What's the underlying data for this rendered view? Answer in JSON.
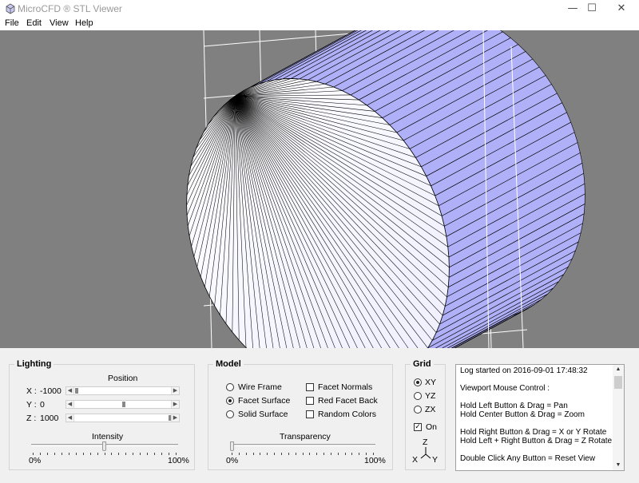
{
  "window": {
    "title": "MicroCFD ® STL Viewer",
    "minimize": "—",
    "maximize": "☐",
    "close": "✕"
  },
  "menu": [
    "File",
    "Edit",
    "View",
    "Help"
  ],
  "colors": {
    "viewport_bg": "#808080",
    "model_fill": "#b0b0f8",
    "model_lit": "#eeeeff",
    "grid": "#ffffff"
  },
  "lighting": {
    "title": "Lighting",
    "position_label": "Position",
    "x": {
      "label": "X :",
      "value": "-1000",
      "fraction": 0.0
    },
    "y": {
      "label": "Y :",
      "value": "0",
      "fraction": 0.5
    },
    "z": {
      "label": "Z :",
      "value": "1000",
      "fraction": 1.0
    },
    "intensity_label": "Intensity",
    "intensity_fraction": 0.5,
    "min_label": "0%",
    "max_label": "100%"
  },
  "model": {
    "title": "Model",
    "options": [
      {
        "label": "Wire Frame",
        "selected": false
      },
      {
        "label": "Facet Surface",
        "selected": true
      },
      {
        "label": "Solid Surface",
        "selected": false
      }
    ],
    "checks": [
      {
        "label": "Facet Normals",
        "checked": false
      },
      {
        "label": "Red Facet Back",
        "checked": false
      },
      {
        "label": "Random Colors",
        "checked": false
      }
    ],
    "transparency_label": "Transparency",
    "transparency_fraction": 0.0,
    "min_label": "0%",
    "max_label": "100%"
  },
  "grid": {
    "title": "Grid",
    "planes": [
      {
        "label": "XY",
        "selected": true
      },
      {
        "label": "YZ",
        "selected": false
      },
      {
        "label": "ZX",
        "selected": false
      }
    ],
    "on_label": "On",
    "on_checked": true,
    "axis_z": "Z",
    "axis_x": "X",
    "axis_y": "Y"
  },
  "log": {
    "lines": [
      "Log started on 2016-09-01 17:48:32",
      "Viewport Mouse Control :",
      "Hold Left Button & Drag  =  Pan",
      "Hold Center Button & Drag  =  Zoom",
      "Hold Right Button & Drag  =  X or Y Rotate",
      "Hold Left + Right Button & Drag  =  Z Rotate",
      "Double Click Any Button  =  Reset View"
    ]
  }
}
